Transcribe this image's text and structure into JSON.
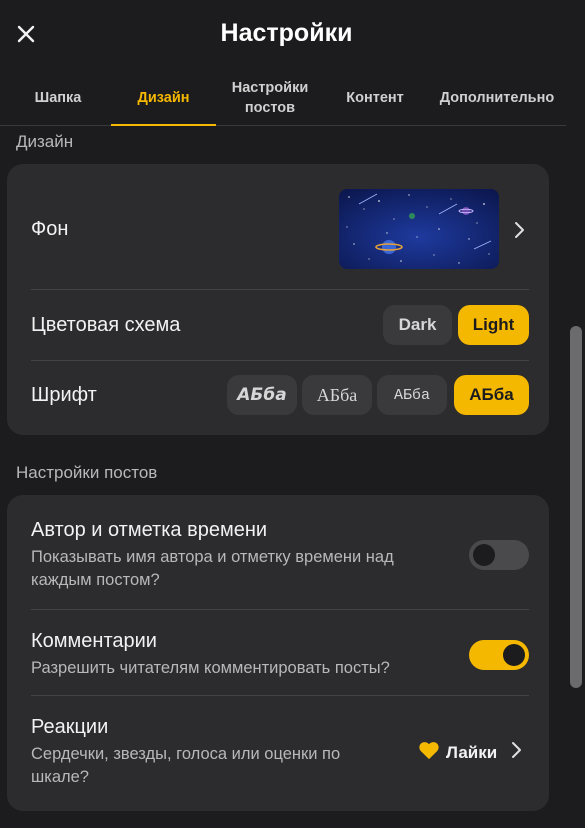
{
  "header": {
    "title": "Настройки"
  },
  "tabs": [
    {
      "label": "Шапка"
    },
    {
      "label": "Дизайн"
    },
    {
      "label": "Настройки постов"
    },
    {
      "label": "Контент"
    },
    {
      "label": "Дополнительно"
    }
  ],
  "active_tab_index": 1,
  "design": {
    "section_label": "Дизайн",
    "background_label": "Фон",
    "color_scheme_label": "Цветовая схема",
    "color_schemes": [
      "Dark",
      "Light"
    ],
    "color_scheme_selected": "Light",
    "font_label": "Шрифт",
    "font_samples": [
      "АБба",
      "АБба",
      "АБба",
      "АБба"
    ],
    "font_selected_index": 3
  },
  "posts": {
    "section_label": "Настройки постов",
    "author": {
      "title": "Автор и отметка времени",
      "desc": "Показывать имя автора и отметку времени над каждым постом?",
      "enabled": false
    },
    "comments": {
      "title": "Комментарии",
      "desc": "Разрешить читателям комментировать посты?",
      "enabled": true
    },
    "reactions": {
      "title": "Реакции",
      "desc": "Сердечки, звезды, голоса или оценки по шкале?",
      "value": "Лайки",
      "icon": "heart-icon"
    }
  },
  "colors": {
    "accent": "#f5b800",
    "background": "#1c1c1e",
    "card": "#2c2c2e"
  }
}
